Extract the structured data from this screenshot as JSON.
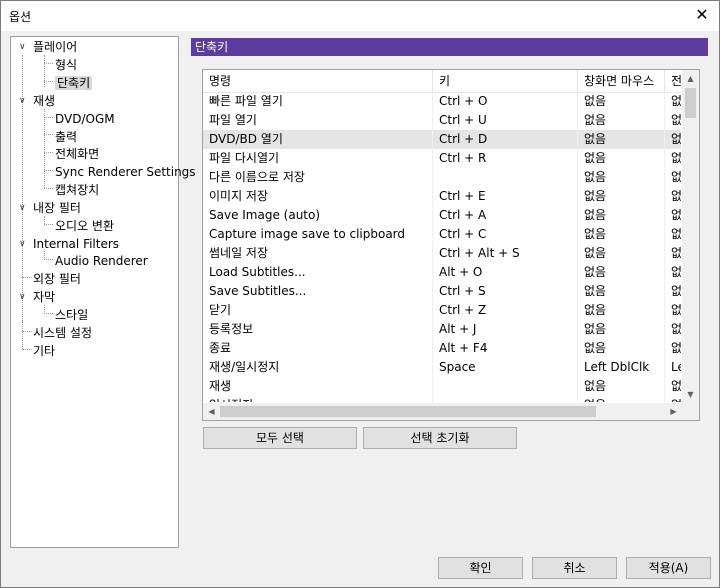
{
  "window": {
    "title": "옵션",
    "close_glyph": "✕"
  },
  "tree": {
    "items": [
      {
        "label": "플레이어",
        "expanded": true
      },
      {
        "label": "형식"
      },
      {
        "label": "단축키",
        "selected": true
      },
      {
        "label": "재생",
        "expanded": true
      },
      {
        "label": "DVD/OGM"
      },
      {
        "label": "출력"
      },
      {
        "label": "전체화면"
      },
      {
        "label": "Sync Renderer Settings"
      },
      {
        "label": "캡쳐장치"
      },
      {
        "label": "내장 필터",
        "expanded": true
      },
      {
        "label": "오디오 변환"
      },
      {
        "label": "Internal Filters",
        "expanded": true
      },
      {
        "label": "Audio Renderer"
      },
      {
        "label": "외장 필터"
      },
      {
        "label": "자막",
        "expanded": true
      },
      {
        "label": "스타일"
      },
      {
        "label": "시스템 설정"
      },
      {
        "label": "기타"
      }
    ]
  },
  "panel": {
    "header": "단축키"
  },
  "table": {
    "columns": [
      "명령",
      "키",
      "창화면 마우스",
      "전"
    ],
    "rows": [
      [
        "빠른 파일 열기",
        "Ctrl + O",
        "없음",
        "없"
      ],
      [
        "파일 열기",
        "Ctrl + U",
        "없음",
        "없"
      ],
      [
        "DVD/BD 열기",
        "Ctrl + D",
        "없음",
        "없"
      ],
      [
        "파일 다시열기",
        "Ctrl + R",
        "없음",
        "없"
      ],
      [
        "다른 이름으로 저장",
        "",
        "없음",
        "없"
      ],
      [
        "이미지 저장",
        "Ctrl + E",
        "없음",
        "없"
      ],
      [
        "Save Image (auto)",
        "Ctrl + A",
        "없음",
        "없"
      ],
      [
        "Capture image save to clipboard",
        "Ctrl + C",
        "없음",
        "없"
      ],
      [
        "썸네일 저장",
        "Ctrl + Alt + S",
        "없음",
        "없"
      ],
      [
        "Load Subtitles...",
        "Alt + O",
        "없음",
        "없"
      ],
      [
        "Save Subtitles...",
        "Ctrl + S",
        "없음",
        "없"
      ],
      [
        "닫기",
        "Ctrl + Z",
        "없음",
        "없"
      ],
      [
        "등록정보",
        "Alt + J",
        "없음",
        "없"
      ],
      [
        "종료",
        "Alt + F4",
        "없음",
        "없"
      ],
      [
        "재생/일시정지",
        "Space",
        "Left DblClk",
        "Le"
      ],
      [
        "재생",
        "",
        "없음",
        "없"
      ],
      [
        "일시정지",
        "",
        "없음",
        "없"
      ]
    ],
    "highlighted_row": 2
  },
  "buttons": {
    "select_all": "모두 선택",
    "reset_selection": "선택 초기화",
    "ok": "확인",
    "cancel": "취소",
    "apply": "적용(A)"
  },
  "colors": {
    "header_bg": "#5c3c9c",
    "row_highlight": "#e5e5e5"
  }
}
